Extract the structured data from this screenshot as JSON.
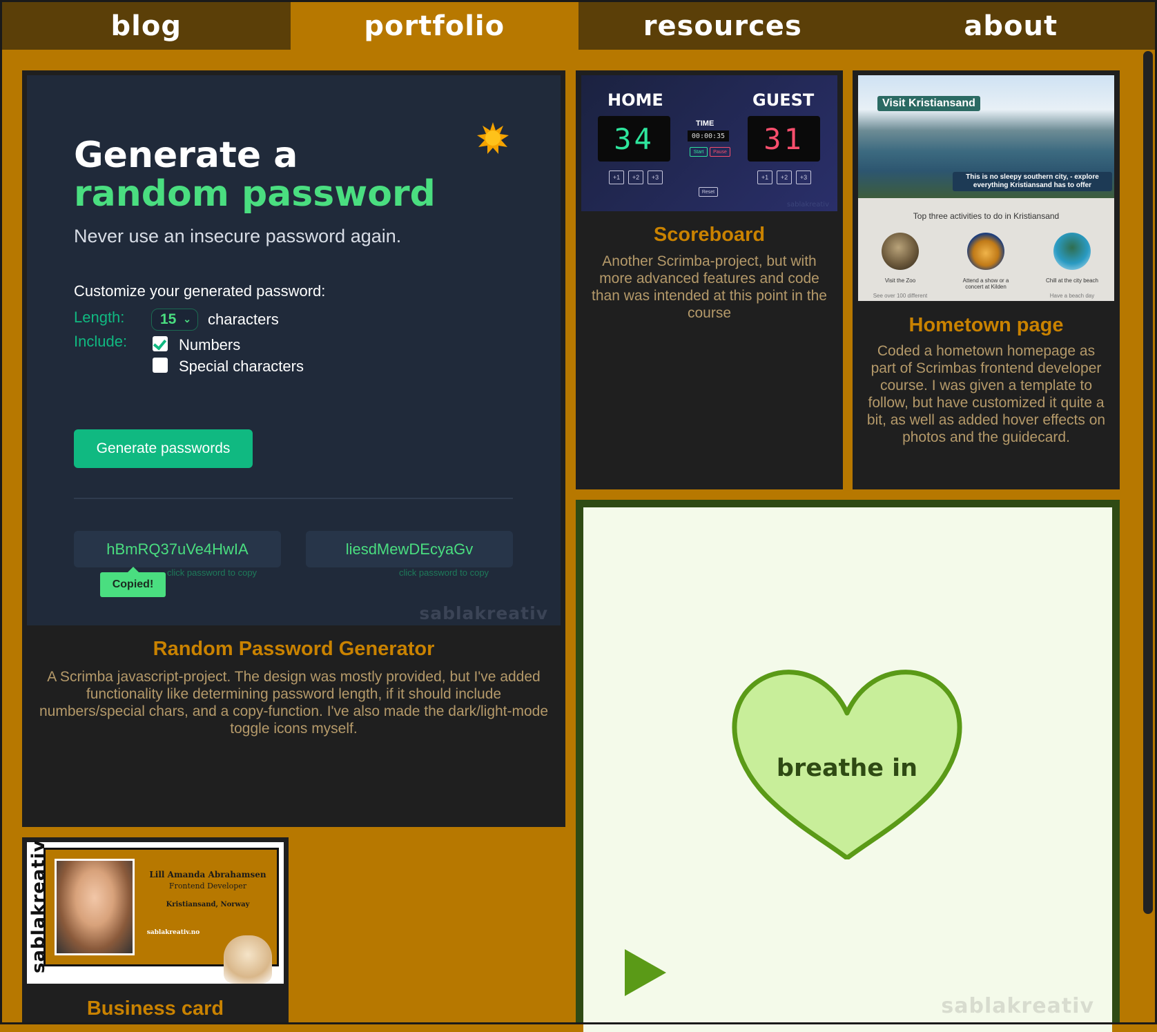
{
  "nav": {
    "tabs": [
      {
        "label": "blog",
        "active": false
      },
      {
        "label": "portfolio",
        "active": true
      },
      {
        "label": "resources",
        "active": false
      },
      {
        "label": "about",
        "active": false
      }
    ]
  },
  "colors": {
    "background": "#b77800",
    "nav_tab": "#5b3f08",
    "card": "#1f1f1f",
    "card_title": "#c98200",
    "accent_green": "#4ade80",
    "button_green": "#10b981"
  },
  "password_card": {
    "app": {
      "heading_line1": "Generate a",
      "heading_line2": "random password",
      "subtitle": "Never use an insecure password again.",
      "customize_label": "Customize your generated password:",
      "length_label": "Length:",
      "length_value": "15",
      "characters_label": "characters",
      "include_label": "Include:",
      "numbers_label": "Numbers",
      "numbers_checked": true,
      "special_label": "Special characters",
      "special_checked": false,
      "generate_button": "Generate passwords",
      "password1": "hBmRQ37uVe4HwIA",
      "password2": "liesdMewDEcyaGv",
      "copy_hint": "click password to copy",
      "copied_label": "Copied!",
      "theme_icon": "sun-icon",
      "watermark": "sablakreativ"
    },
    "title": "Random Password Generator",
    "description": "A Scrimba javascript-project. The design was mostly provided, but I've added functionality like determining password length, if it should include numbers/special chars, and a copy-function. I've also made the dark/light-mode toggle icons myself."
  },
  "scoreboard_card": {
    "app": {
      "home_label": "HOME",
      "guest_label": "GUEST",
      "home_score": "34",
      "guest_score": "31",
      "time_label": "TIME",
      "time_value": "00:00:35",
      "buttons": [
        "+1",
        "+2",
        "+3"
      ],
      "start_label": "Start",
      "pause_label": "Pause",
      "reset_label": "Reset",
      "watermark": "sablakreativ"
    },
    "title": "Scoreboard",
    "description": "Another Scrimba-project, but with more advanced features and code than was intended at this point in the course"
  },
  "hometown_card": {
    "app": {
      "hero_title": "Visit Kristiansand",
      "hero_caption": "This is no sleepy southern city, - explore everything Kristiansand has to offer",
      "section_title": "Top three activities to do in Kristiansand",
      "activities": [
        {
          "label": "Visit the Zoo",
          "sub": "See over 100 different"
        },
        {
          "label": "Attend a show or a concert at Kilden",
          "sub": ""
        },
        {
          "label": "Chill at the city beach",
          "sub": "Have a beach day"
        }
      ]
    },
    "title": "Hometown page",
    "description": "Coded a hometown homepage as part of Scrimbas frontend developer course. I was given a template to follow, but have customized it quite a bit, as well as added hover effects on photos and the guidecard."
  },
  "breathe_card": {
    "text": "breathe in",
    "watermark": "sablakreativ",
    "play_icon": "play-icon"
  },
  "business_card": {
    "app": {
      "vertical_text": "sablakreativ",
      "name": "Lill Amanda Abrahamsen",
      "role": "Frontend Developer",
      "location": "Kristiansand, Norway",
      "website": "sablakreativ.no"
    },
    "title": "Business card"
  }
}
